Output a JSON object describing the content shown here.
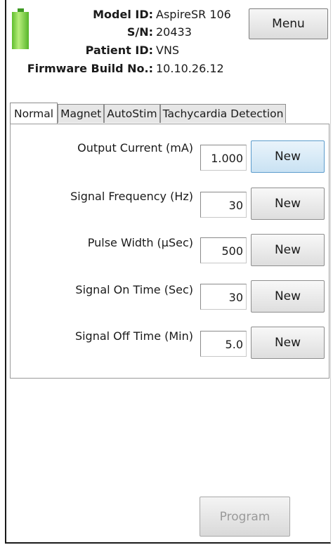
{
  "header": {
    "battery_icon": "battery-full-icon",
    "battery_color": "#5fbe2d",
    "model_id_label": "Model ID:",
    "model_id_value": "AspireSR 106",
    "sn_label": "S/N:",
    "sn_value": "20433",
    "patient_id_label": "Patient ID:",
    "patient_id_value": "VNS",
    "firmware_label": "Firmware Build No.:",
    "firmware_value": "10.10.26.12",
    "menu_label": "Menu"
  },
  "tabs": [
    {
      "label": "Normal",
      "active": true
    },
    {
      "label": "Magnet",
      "active": false
    },
    {
      "label": "AutoStim",
      "active": false
    },
    {
      "label": "Tachycardia Detection",
      "active": false
    }
  ],
  "params": [
    {
      "label": "Output Current (mA)",
      "value": "1.000",
      "button": "New"
    },
    {
      "label": "Signal Frequency (Hz)",
      "value": "30",
      "button": "New"
    },
    {
      "label": "Pulse Width (µSec)",
      "value": "500",
      "button": "New"
    },
    {
      "label": "Signal On Time (Sec)",
      "value": "30",
      "button": "New"
    },
    {
      "label": "Signal Off Time (Min)",
      "value": "5.0",
      "button": "New"
    }
  ],
  "footer": {
    "program_label": "Program",
    "program_enabled": false
  }
}
